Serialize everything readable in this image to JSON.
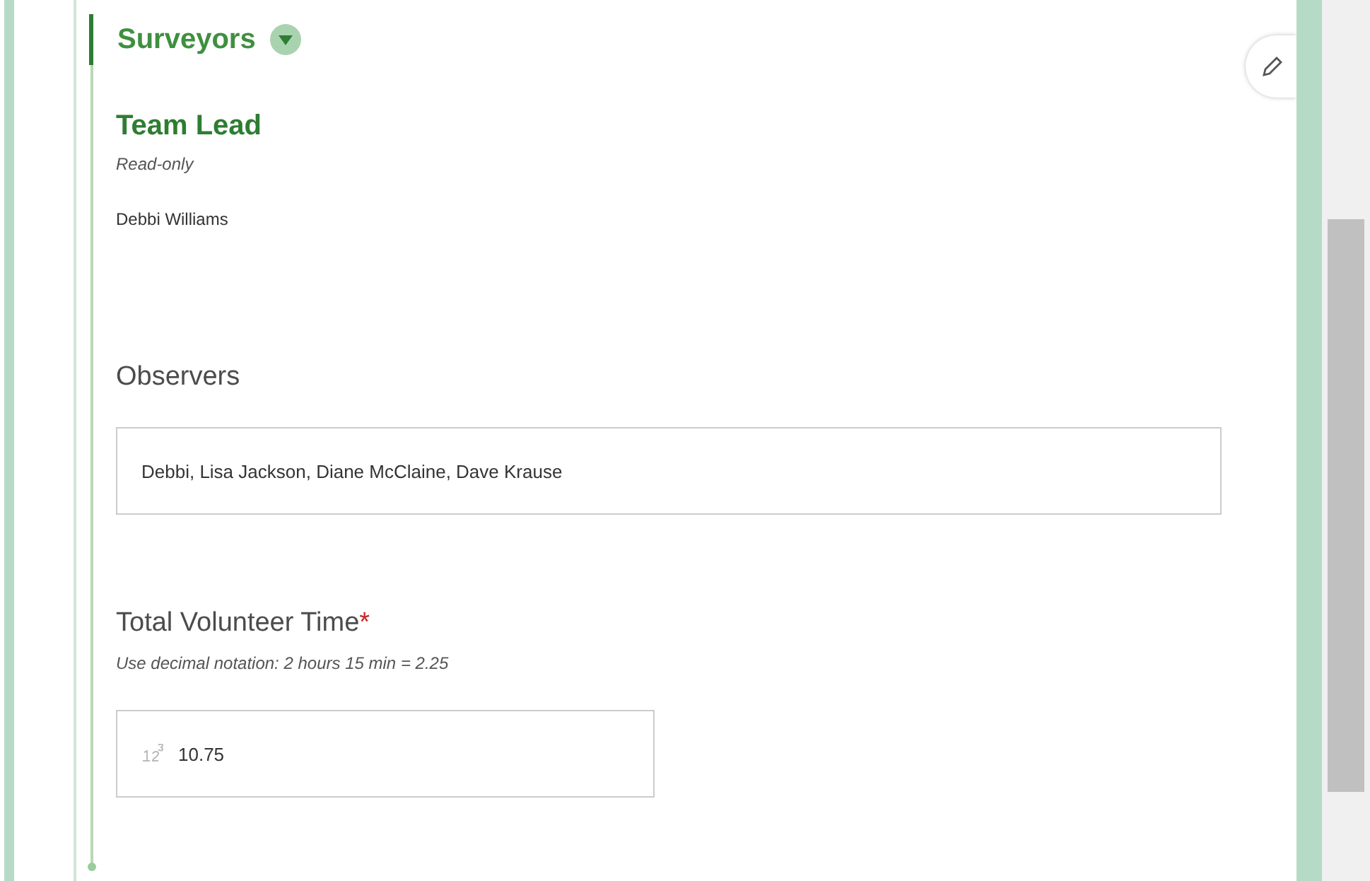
{
  "section": {
    "title": "Surveyors",
    "expanded": true
  },
  "fields": [
    {
      "kind": "readonly",
      "label": "Team Lead",
      "note": "Read-only",
      "value": "Debbi Williams"
    },
    {
      "kind": "text",
      "label": "Observers",
      "value": "Debbi, Lisa Jackson, Diane McClaine, Dave Krause"
    },
    {
      "kind": "number",
      "label": "Total Volunteer Time",
      "required_mark": "*",
      "hint": "Use decimal notation: 2 hours 15 min = 2.25",
      "value": "10.75"
    }
  ]
}
